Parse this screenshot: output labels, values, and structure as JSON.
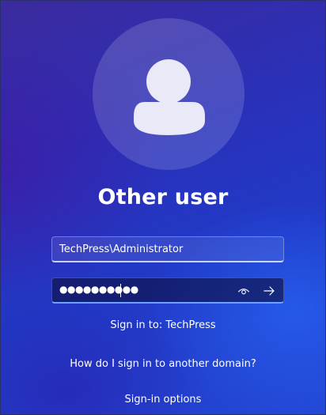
{
  "login": {
    "title": "Other user",
    "username_value": "TechPress\\Administrator",
    "password_mask": "●●●●●●●●●●",
    "sign_in_to": "Sign in to: TechPress",
    "other_domain_link": "How do I sign in to another domain?",
    "sign_in_options": "Sign-in options"
  },
  "icons": {
    "avatar": "user-silhouette-icon",
    "reveal": "eye-icon",
    "submit": "arrow-right-icon"
  },
  "colors": {
    "background": "#2a30b8",
    "text": "#ffffff",
    "focus_underline": "#6fa0ff"
  }
}
